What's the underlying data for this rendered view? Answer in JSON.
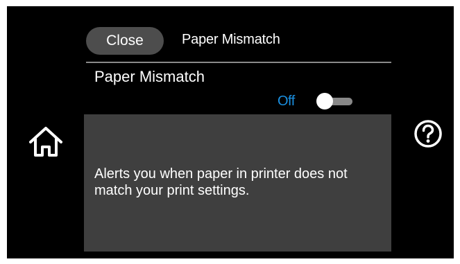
{
  "header": {
    "close_label": "Close",
    "title": "Paper Mismatch"
  },
  "setting": {
    "title": "Paper Mismatch",
    "state_label": "Off",
    "enabled": false,
    "description": "Alerts you when paper in printer does not match your print settings."
  },
  "icons": {
    "home": "home-icon",
    "help": "help-icon"
  },
  "colors": {
    "screen_background": "#000000",
    "panel_background": "#3f3f3f",
    "button_background": "#4d4d4d",
    "accent": "#1a8fe0",
    "text": "#ffffff"
  }
}
